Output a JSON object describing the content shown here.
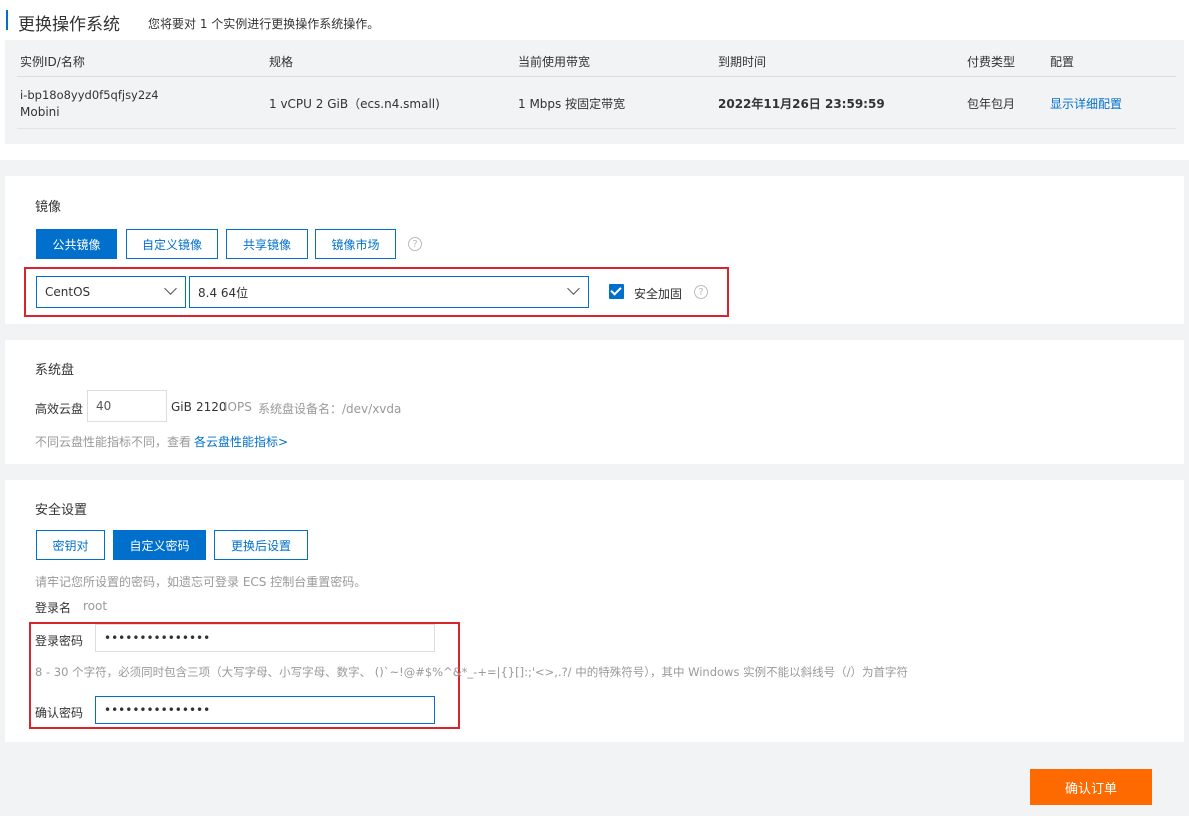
{
  "header": {
    "title": "更换操作系统",
    "subtitle": "您将要对 1 个实例进行更换操作系统操作。"
  },
  "table": {
    "headers": [
      "实例ID/名称",
      "规格",
      "当前使用带宽",
      "到期时间",
      "付费类型",
      "配置"
    ],
    "row": {
      "instance_id": "i-bp18o8yyd0f5qfjsy2z4",
      "instance_name": "Mobini",
      "spec": "1 vCPU 2 GiB（ecs.n4.small)",
      "bandwidth": "1 Mbps 按固定带宽",
      "expire": "2022年11月26日 23:59:59",
      "billing": "包年包月",
      "config_link": "显示详细配置"
    }
  },
  "image": {
    "section_title": "镜像",
    "tabs": [
      "公共镜像",
      "自定义镜像",
      "共享镜像",
      "镜像市场"
    ],
    "os_value": "CentOS",
    "version_value": "8.4 64位",
    "security_label": "安全加固",
    "help": "?"
  },
  "disk": {
    "section_title": "系统盘",
    "type_label": "高效云盘",
    "size_value": "40",
    "unit": "GiB",
    "iops_value": "2120",
    "iops_label": "IOPS",
    "device_text": "系统盘设备名：/dev/xvda",
    "hint_text": "不同云盘性能指标不同，查看",
    "hint_link": "各云盘性能指标>"
  },
  "security": {
    "section_title": "安全设置",
    "tabs": [
      "密钥对",
      "自定义密码",
      "更换后设置"
    ],
    "note": "请牢记您所设置的密码，如遗忘可登录 ECS 控制台重置密码。",
    "login_label": "登录名",
    "login_value": "root",
    "password_label": "登录密码",
    "password_value": "•••••••••••••••",
    "password_rule": "8 - 30 个字符，必须同时包含三项（大写字母、小写字母、数字、 ()`~!@#$%^&*_-+=|{}[]:;'<>,.?/ 中的特殊符号），其中 Windows 实例不能以斜线号（/）为首字符",
    "confirm_label": "确认密码",
    "confirm_value": "•••••••••••••••"
  },
  "footer": {
    "confirm_button": "确认订单"
  },
  "colors": {
    "primary": "#0070cc",
    "accent": "#ff6a00",
    "highlight": "#d9232d"
  }
}
